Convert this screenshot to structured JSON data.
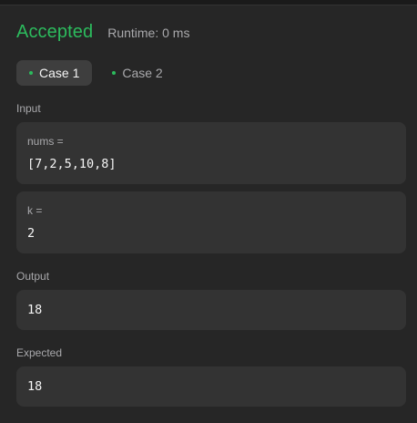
{
  "result": {
    "status": "Accepted",
    "runtime": "Runtime: 0 ms"
  },
  "tabs": [
    {
      "label": "Case 1",
      "active": true
    },
    {
      "label": "Case 2",
      "active": false
    }
  ],
  "input": {
    "label": "Input",
    "params": [
      {
        "name": "nums =",
        "value": "[7,2,5,10,8]"
      },
      {
        "name": "k =",
        "value": "2"
      }
    ]
  },
  "output": {
    "label": "Output",
    "value": "18"
  },
  "expected": {
    "label": "Expected",
    "value": "18"
  },
  "colors": {
    "accepted": "#2cbb5d",
    "background": "#262626",
    "panel": "#333333",
    "active_tab": "#3e3e3e"
  }
}
